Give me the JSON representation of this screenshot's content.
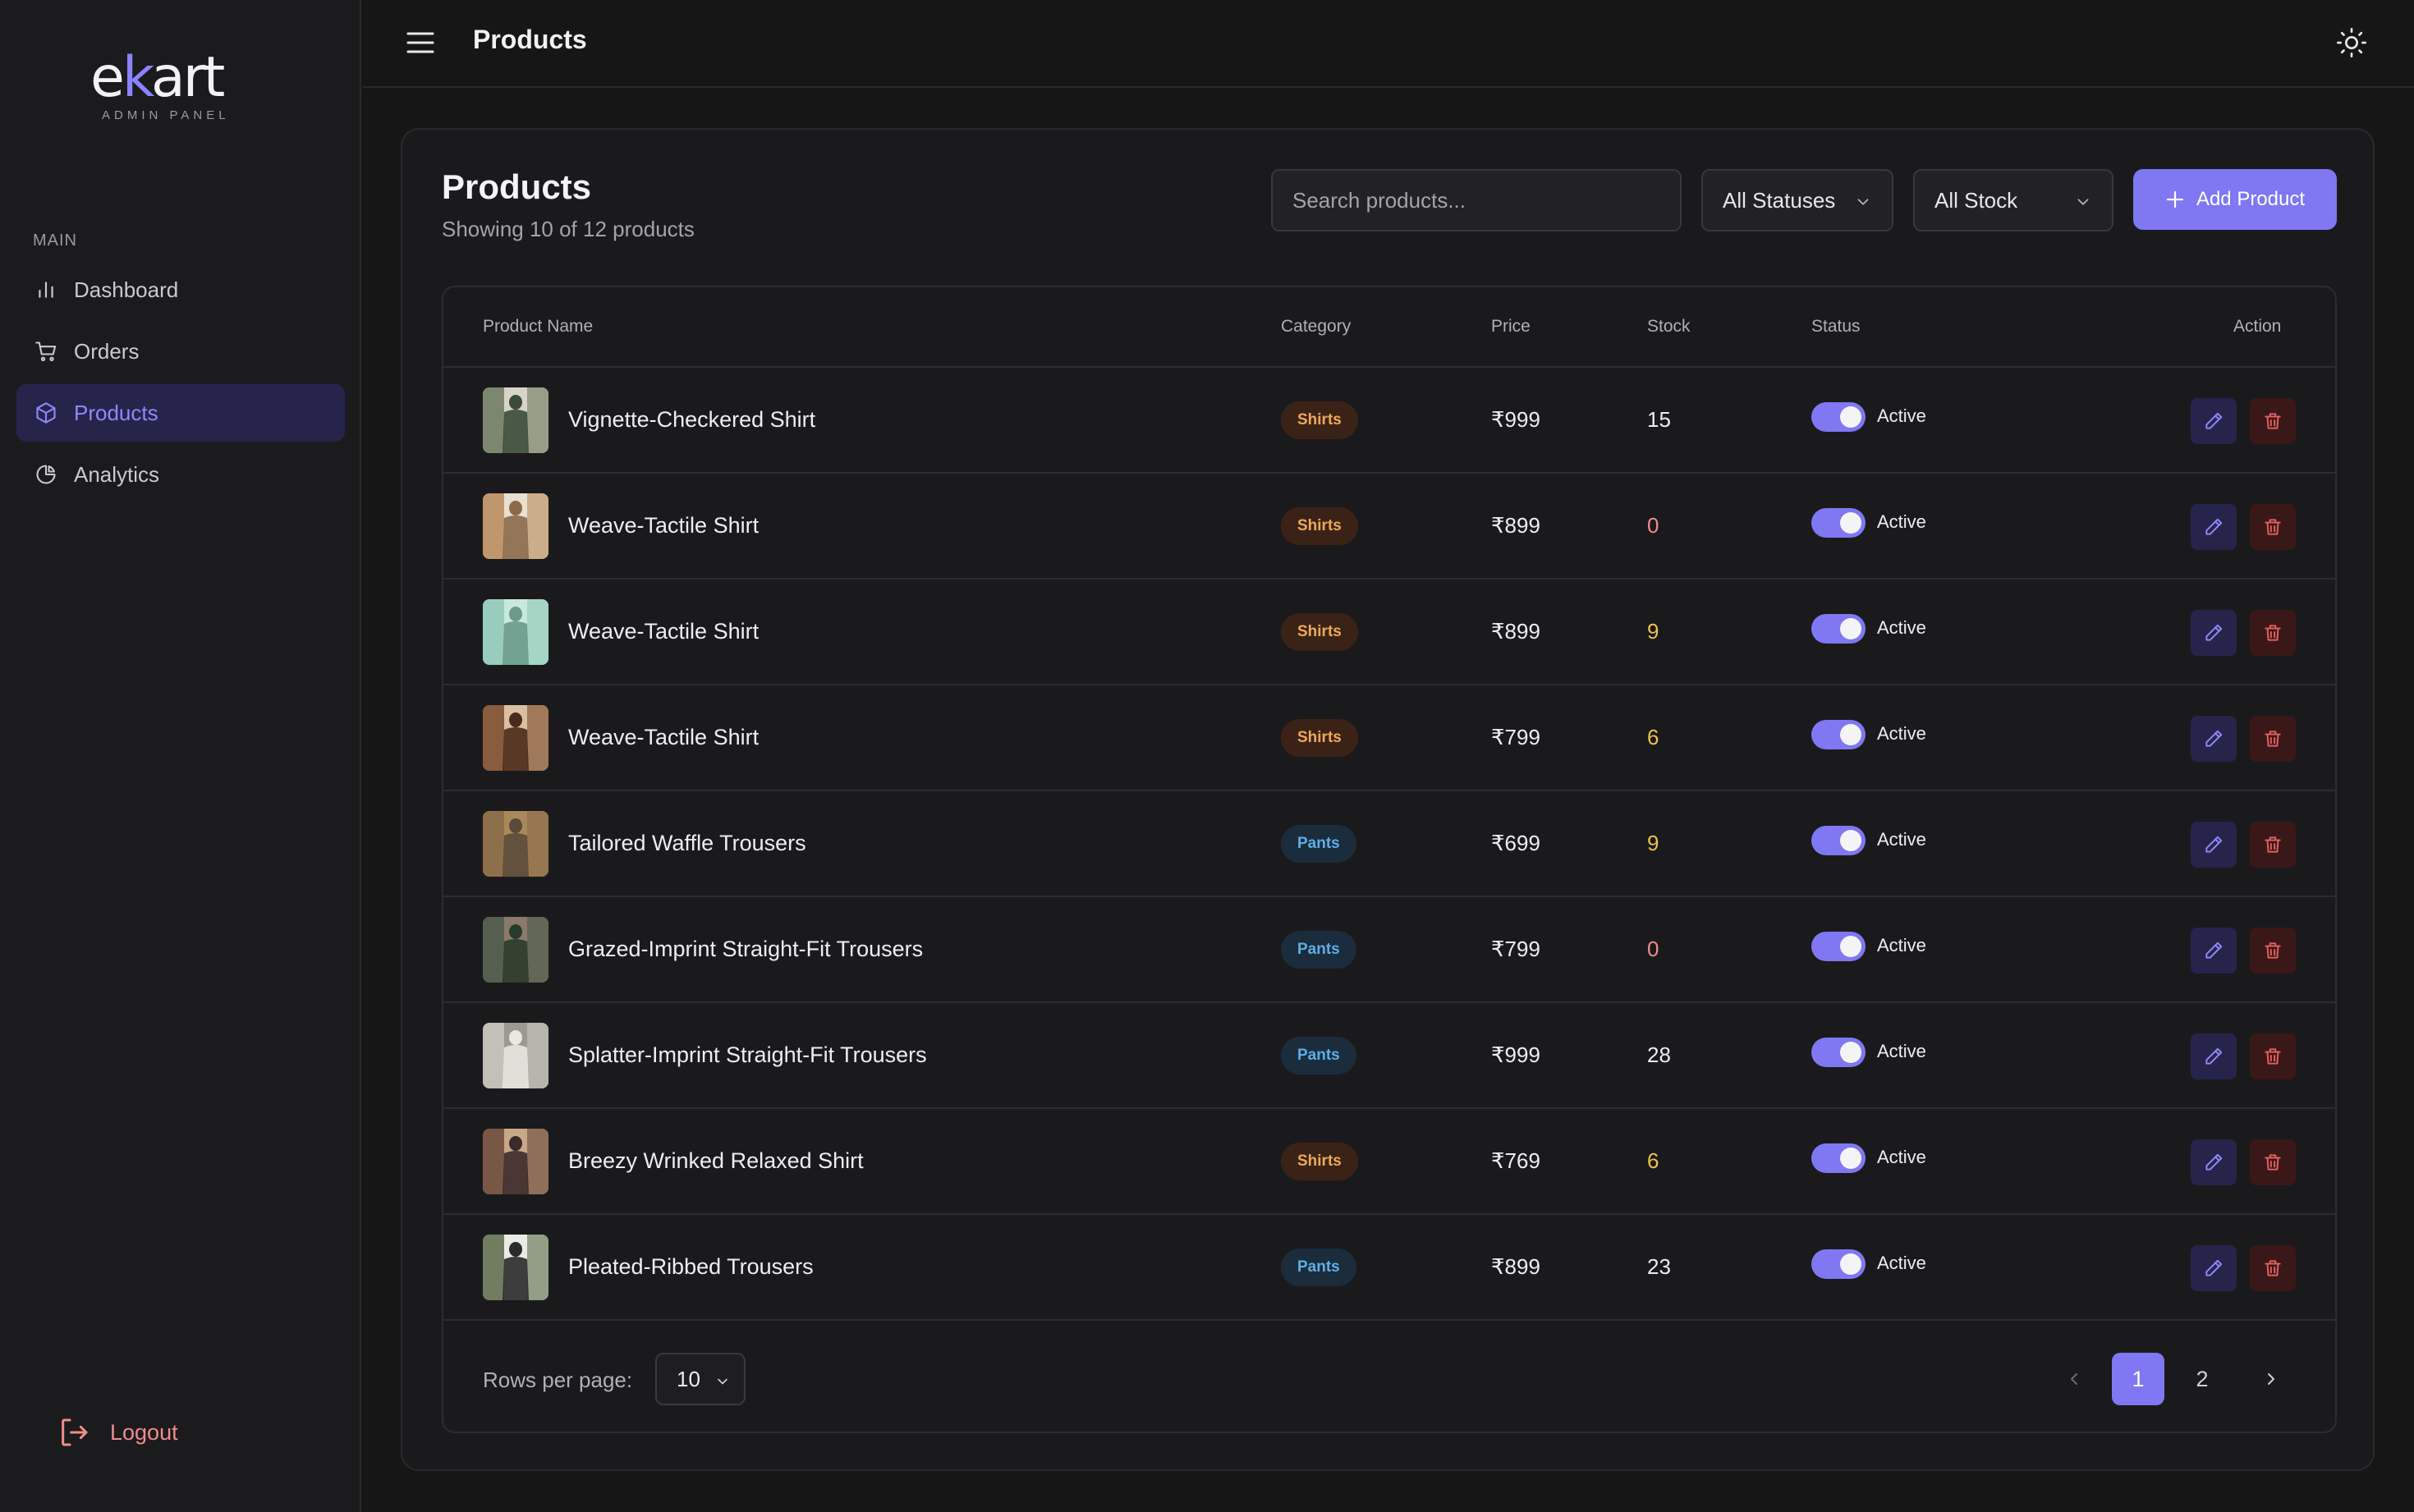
{
  "brand": {
    "logo_pre": "e",
    "logo_k": "k",
    "logo_post": "art",
    "subtitle": "ADMIN PANEL"
  },
  "sidebar": {
    "section_label": "MAIN",
    "items": [
      {
        "label": "Dashboard",
        "icon": "bar-chart-icon",
        "active": false
      },
      {
        "label": "Orders",
        "icon": "cart-icon",
        "active": false
      },
      {
        "label": "Products",
        "icon": "box-icon",
        "active": true
      },
      {
        "label": "Analytics",
        "icon": "pie-chart-icon",
        "active": false
      }
    ],
    "logout_label": "Logout"
  },
  "topbar": {
    "title": "Products"
  },
  "card": {
    "title": "Products",
    "subtitle": "Showing 10 of 12 products",
    "search_placeholder": "Search products...",
    "status_filter": "All Statuses",
    "stock_filter": "All Stock",
    "add_label": "Add Product"
  },
  "table": {
    "headers": {
      "name": "Product Name",
      "category": "Category",
      "price": "Price",
      "stock": "Stock",
      "status": "Status",
      "action": "Action"
    },
    "rows": [
      {
        "name": "Vignette-Checkered Shirt",
        "category": "Shirts",
        "price": "₹999",
        "stock": "15",
        "status": "Active",
        "thumb": [
          "#6b7a5e",
          "#d8d4c8",
          "#3b4a3a"
        ]
      },
      {
        "name": "Weave-Tactile Shirt",
        "category": "Shirts",
        "price": "₹899",
        "stock": "0",
        "status": "Active",
        "thumb": [
          "#b88a5a",
          "#e8e0d0",
          "#8a6a4a"
        ]
      },
      {
        "name": "Weave-Tactile Shirt",
        "category": "Shirts",
        "price": "₹899",
        "stock": "9",
        "status": "Active",
        "thumb": [
          "#8fc8b8",
          "#c8e8dc",
          "#6a9a8a"
        ]
      },
      {
        "name": "Weave-Tactile Shirt",
        "category": "Shirts",
        "price": "₹799",
        "stock": "6",
        "status": "Active",
        "thumb": [
          "#7a4a2a",
          "#d8c0a0",
          "#4a2a1a"
        ]
      },
      {
        "name": "Tailored Waffle Trousers",
        "category": "Pants",
        "price": "₹699",
        "stock": "9",
        "status": "Active",
        "thumb": [
          "#8a6a4a",
          "#a88a5a",
          "#5a4a3a"
        ]
      },
      {
        "name": "Grazed-Imprint Straight-Fit Trousers",
        "category": "Pants",
        "price": "₹799",
        "stock": "0",
        "status": "Active",
        "thumb": [
          "#4a5a4a",
          "#8a7a6a",
          "#2a3a2a"
        ]
      },
      {
        "name": "Splatter-Imprint Straight-Fit Trousers",
        "category": "Pants",
        "price": "₹999",
        "stock": "28",
        "status": "Active",
        "thumb": [
          "#c8c8c0",
          "#9a9a90",
          "#e8e8e0"
        ]
      },
      {
        "name": "Breezy Wrinked Relaxed Shirt",
        "category": "Shirts",
        "price": "₹769",
        "stock": "6",
        "status": "Active",
        "thumb": [
          "#6a4a3a",
          "#c8a888",
          "#3a2a2a"
        ]
      },
      {
        "name": "Pleated-Ribbed Trousers",
        "category": "Pants",
        "price": "₹899",
        "stock": "23",
        "status": "Active",
        "thumb": [
          "#5a6a4a",
          "#e8ece4",
          "#2a2a2a"
        ]
      }
    ],
    "rows_per_page_label": "Rows per page:",
    "rows_per_page": "10",
    "pages": [
      "1",
      "2"
    ],
    "current_page": "1"
  },
  "colors": {
    "accent": "#7f78f2",
    "danger": "#f08c8c",
    "warning": "#f0c24a",
    "shirts": "#f0a85a",
    "pants": "#5eaee8"
  }
}
